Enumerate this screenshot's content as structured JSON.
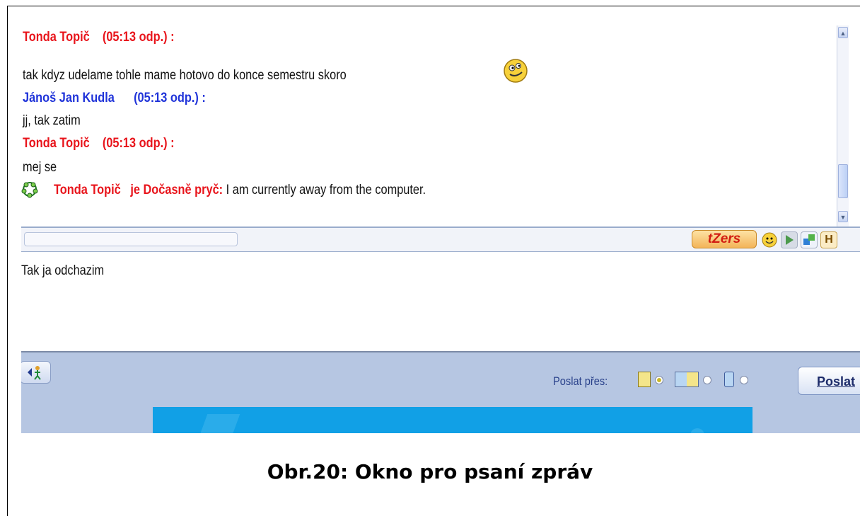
{
  "messages": [
    {
      "sender": "Tonda Topič",
      "time": "(05:13 odp.) :",
      "text": "tak kdyz udelame tohle mame hotovo do konce semestru skoro",
      "emoticon": "winking-smiley-icon"
    },
    {
      "sender": "Jánoš Jan Kudla",
      "time": "(05:13 odp.) :",
      "text": "jj, tak zatim"
    },
    {
      "sender": "Tonda Topič",
      "time": "(05:13 odp.) :",
      "text": "mej se"
    }
  ],
  "status_line": {
    "name": "Tonda Topič",
    "status": "je Dočasně pryč:",
    "message": "I am currently away from the computer.",
    "icon": "away-status-icon"
  },
  "toolbar": {
    "tzers_label": "tZers",
    "icons": [
      "smiley-icon",
      "animation-icon",
      "puzzle-icon",
      "history-icon"
    ],
    "history_label": "H"
  },
  "input": {
    "value": "Tak ja odchazim"
  },
  "bottom": {
    "send_via_label": "Poslat přes:",
    "send_options": [
      "icq-network-icon",
      "sms-and-icq-icon",
      "mobile-sms-icon"
    ],
    "selected_option": 0,
    "send_button": "Poslat"
  },
  "caption": "Obr.20: Okno pro psaní zpráv",
  "colors": {
    "sender_a": "#e8141b",
    "sender_b": "#1f33d9",
    "bar": "#b6c6e2",
    "banner": "#11a0e6"
  }
}
